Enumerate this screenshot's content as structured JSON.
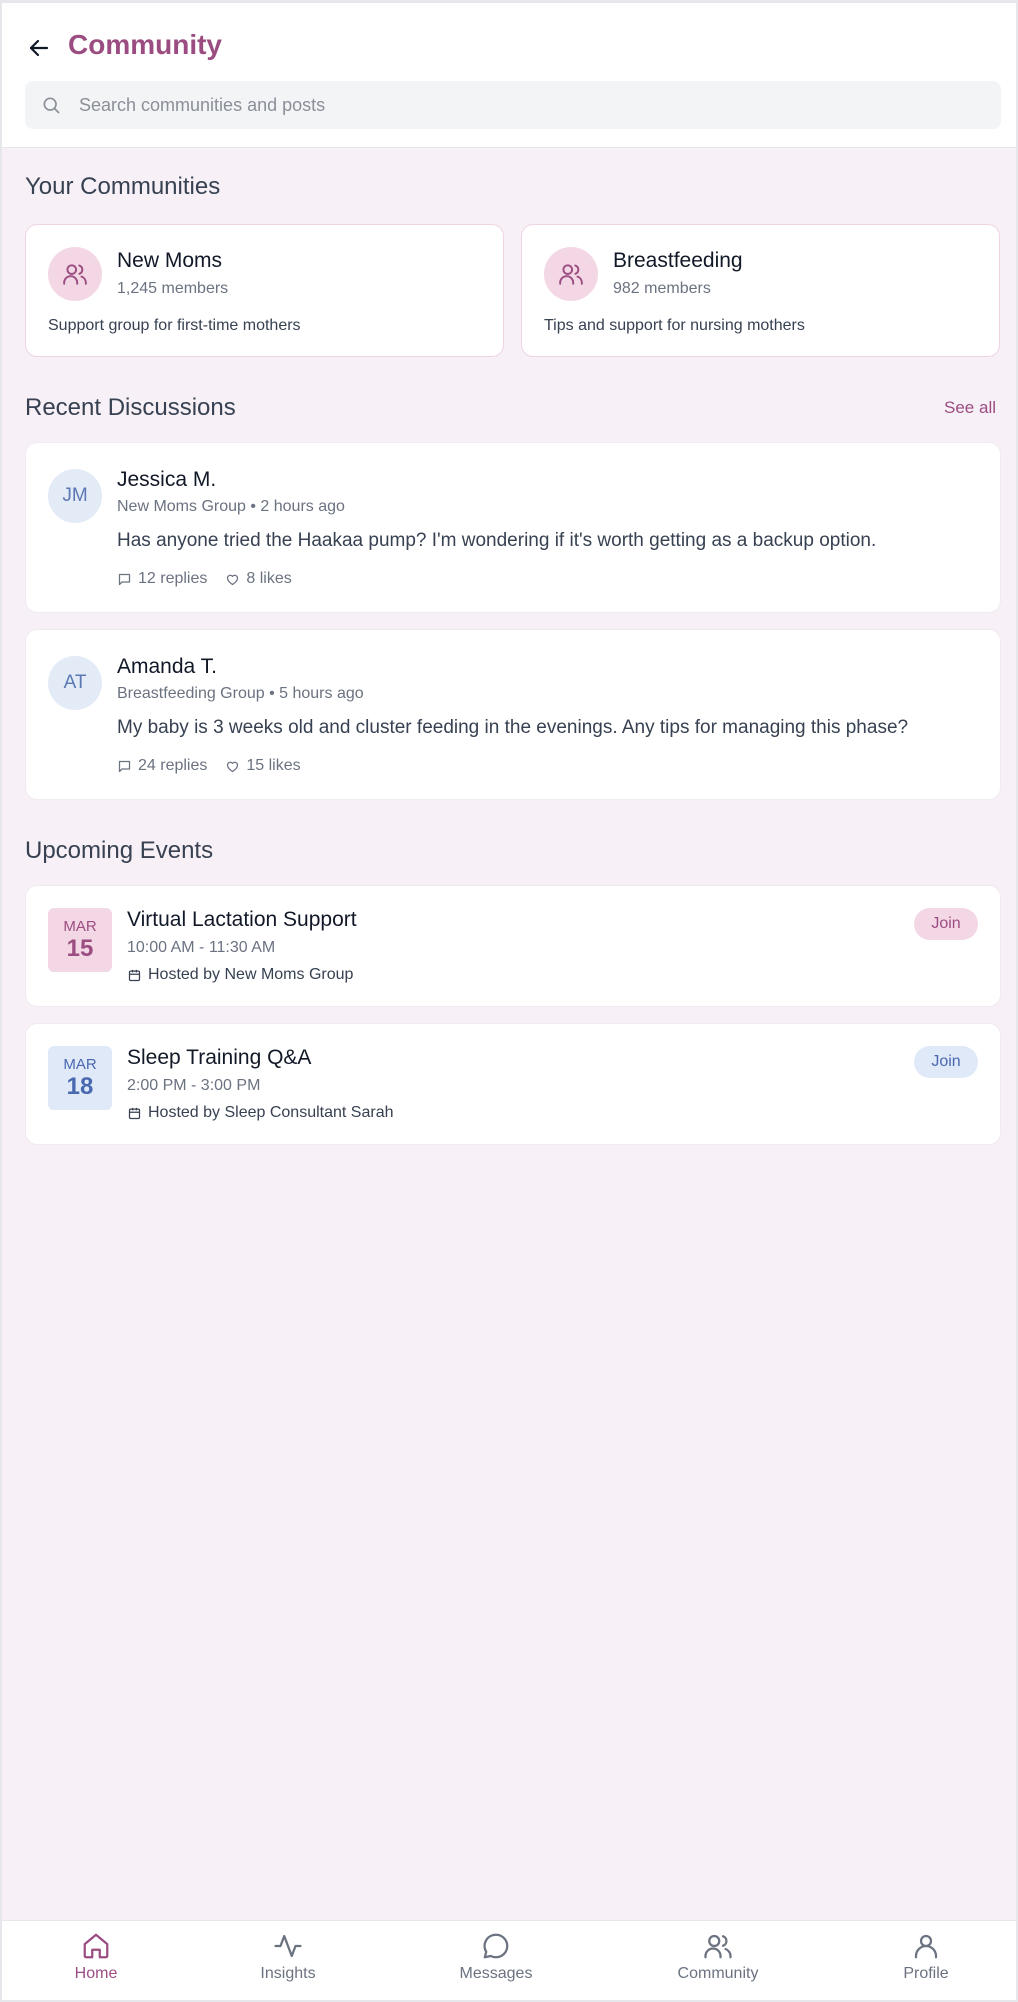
{
  "header": {
    "title": "Community",
    "search_placeholder": "Search communities and posts"
  },
  "your_communities": {
    "title": "Your Communities",
    "items": [
      {
        "name": "New Moms",
        "members": "1,245 members",
        "description": "Support group for first-time mothers"
      },
      {
        "name": "Breastfeeding",
        "members": "982 members",
        "description": "Tips and support for nursing mothers"
      }
    ]
  },
  "recent_discussions": {
    "title": "Recent Discussions",
    "see_all": "See all",
    "items": [
      {
        "initials": "JM",
        "author": "Jessica M.",
        "meta": "New Moms Group • 2 hours ago",
        "text": "Has anyone tried the Haakaa pump? I'm wondering if it's worth getting as a backup option.",
        "replies": "12 replies",
        "likes": "8 likes"
      },
      {
        "initials": "AT",
        "author": "Amanda T.",
        "meta": "Breastfeeding Group • 5 hours ago",
        "text": "My baby is 3 weeks old and cluster feeding in the evenings. Any tips for managing this phase?",
        "replies": "24 replies",
        "likes": "15 likes"
      }
    ]
  },
  "upcoming_events": {
    "title": "Upcoming Events",
    "items": [
      {
        "month": "MAR",
        "day": "15",
        "title": "Virtual Lactation Support",
        "time": "10:00 AM - 11:30 AM",
        "host": "Hosted by New Moms Group",
        "join": "Join",
        "theme": "pink"
      },
      {
        "month": "MAR",
        "day": "18",
        "title": "Sleep Training Q&A",
        "time": "2:00 PM - 3:00 PM",
        "host": "Hosted by Sleep Consultant Sarah",
        "join": "Join",
        "theme": "blue"
      }
    ]
  },
  "bottom_nav": {
    "items": [
      {
        "label": "Home",
        "icon": "home-icon",
        "active": true
      },
      {
        "label": "Insights",
        "icon": "activity-icon",
        "active": false
      },
      {
        "label": "Messages",
        "icon": "message-icon",
        "active": false
      },
      {
        "label": "Community",
        "icon": "users-icon",
        "active": false
      },
      {
        "label": "Profile",
        "icon": "user-icon",
        "active": false
      }
    ]
  },
  "colors": {
    "accent": "#9b4d82",
    "pink_bg": "#f3d7e5",
    "blue_bg": "#dfe9f7",
    "blue_text": "#4a68b0",
    "page_bg": "#f7f0f6"
  }
}
